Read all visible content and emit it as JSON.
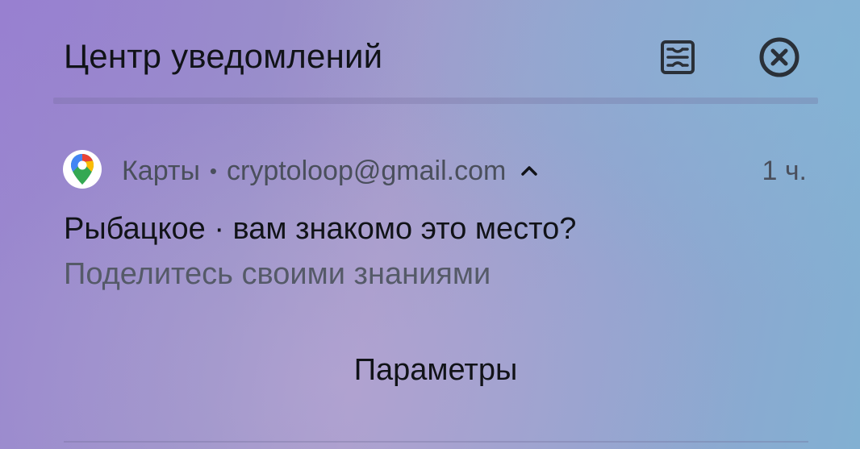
{
  "header": {
    "title": "Центр уведомлений",
    "manage_icon": "notification-settings-icon",
    "close_icon": "close-circle-icon"
  },
  "notification": {
    "app_icon": "google-maps-icon",
    "app_name": "Карты",
    "separator": "•",
    "account": "cryptoloop@gmail.com",
    "expand_icon": "chevron-up-icon",
    "time": "1 ч.",
    "title": "Рыбацкое · вам знакомо это место?",
    "body": "Поделитесь своими знаниями"
  },
  "footer": {
    "params_label": "Параметры"
  },
  "colors": {
    "text_primary": "#111318",
    "text_secondary": "#4a4f5c",
    "background_start": "#9a86cf",
    "background_end": "#82b0d2"
  }
}
